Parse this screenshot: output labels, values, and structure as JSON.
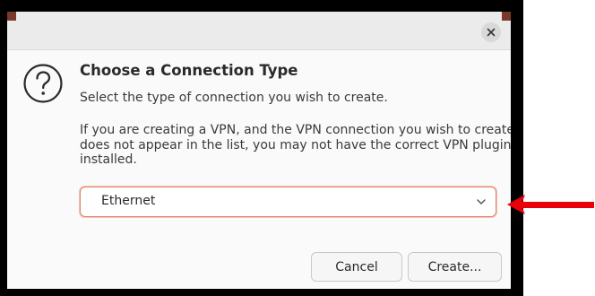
{
  "dialog": {
    "title": "Choose a Connection Type",
    "subtitle": "Select the type of connection you wish to create.",
    "info_lines": [
      "If you are creating a VPN, and the VPN connection you wish to create",
      "does not appear in the list, you may not have the correct VPN plugin",
      "installed."
    ],
    "connection_type": {
      "selected": "Ethernet"
    },
    "buttons": {
      "cancel": "Cancel",
      "create": "Create..."
    }
  },
  "icons": {
    "close": "close-icon",
    "question": "question-icon",
    "dropdown": "chevron-down-icon",
    "annotation": "red-arrow-annotation"
  },
  "colors": {
    "focus_border": "#e0856b",
    "annotation_arrow": "#e8000b"
  }
}
